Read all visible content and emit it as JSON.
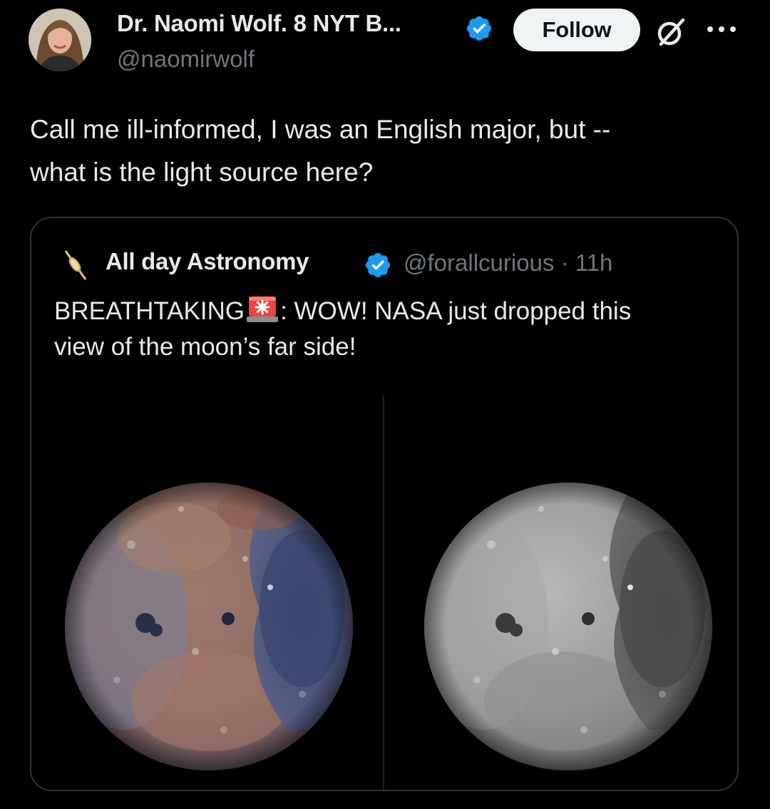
{
  "tweet": {
    "author": {
      "name": "Dr. Naomi Wolf. 8 NYT B...",
      "handle": "@naomirwolf",
      "verified": true
    },
    "follow_label": "Follow",
    "text_line1": "Call me ill-informed, I was an English major, but --",
    "text_line2": "what is the light source here?"
  },
  "quote": {
    "author": {
      "name": "All day Astronomy",
      "handle": "@forallcurious · 11h",
      "verified": true
    },
    "text_part1": "BREATHTAKING",
    "text_part2": ": WOW! NASA just dropped this",
    "text_line2": "view of the moon’s far side!",
    "media": [
      {
        "kind": "photo",
        "subject": "moon-color",
        "palette": [
          "#8a6c63",
          "#a97a66",
          "#3d4a72",
          "#6f7f9c"
        ]
      },
      {
        "kind": "photo",
        "subject": "moon-grayscale",
        "palette": [
          "#b3b3b3",
          "#8c8c8c",
          "#4b4b4b",
          "#6a6a6a"
        ]
      }
    ]
  },
  "colors": {
    "background": "#000000",
    "text_primary": "#e7e9ea",
    "text_secondary": "#71767b",
    "verified_blue": "#1d9bf0",
    "border": "#2f3336",
    "follow_bg": "#eff3f4"
  },
  "icons": [
    "verified-badge-icon",
    "grok-icon",
    "more-icon",
    "saturn-avatar-icon",
    "siren-emoji-icon"
  ]
}
